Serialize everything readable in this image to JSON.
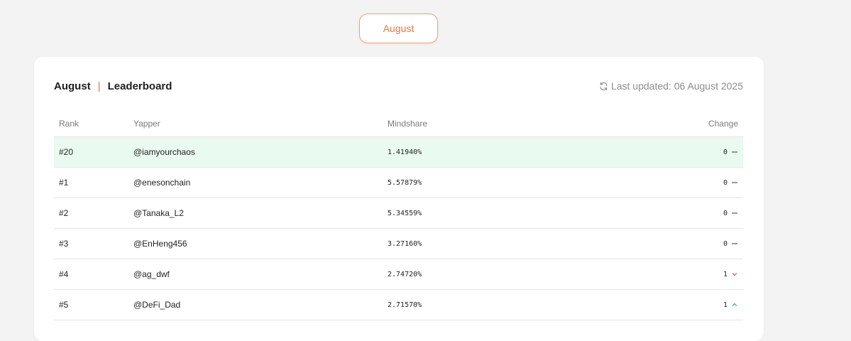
{
  "month_tab": {
    "label": "August"
  },
  "header": {
    "month": "August",
    "separator": "|",
    "title": "Leaderboard",
    "updated_text": "Last updated: 06 August 2025"
  },
  "table": {
    "columns": {
      "rank": "Rank",
      "yapper": "Yapper",
      "mindshare": "Mindshare",
      "change": "Change"
    },
    "rows": [
      {
        "rank": "#20",
        "yapper": "@iamyourchaos",
        "mindshare": "1.41940%",
        "change": "0",
        "trend": "flat",
        "highlight": true
      },
      {
        "rank": "#1",
        "yapper": "@enesonchain",
        "mindshare": "5.57879%",
        "change": "0",
        "trend": "flat"
      },
      {
        "rank": "#2",
        "yapper": "@Tanaka_L2",
        "mindshare": "5.34559%",
        "change": "0",
        "trend": "flat"
      },
      {
        "rank": "#3",
        "yapper": "@EnHeng456",
        "mindshare": "3.27160%",
        "change": "0",
        "trend": "flat"
      },
      {
        "rank": "#4",
        "yapper": "@ag_dwf",
        "mindshare": "2.74720%",
        "change": "1",
        "trend": "down"
      },
      {
        "rank": "#5",
        "yapper": "@DeFi_Dad",
        "mindshare": "2.71570%",
        "change": "1",
        "trend": "up"
      }
    ]
  },
  "colors": {
    "accent": "#e8783a",
    "highlight_row": "#e9fbf1",
    "trend_flat": "#555555",
    "trend_down": "#e05a6a",
    "trend_up": "#2fb37a"
  }
}
